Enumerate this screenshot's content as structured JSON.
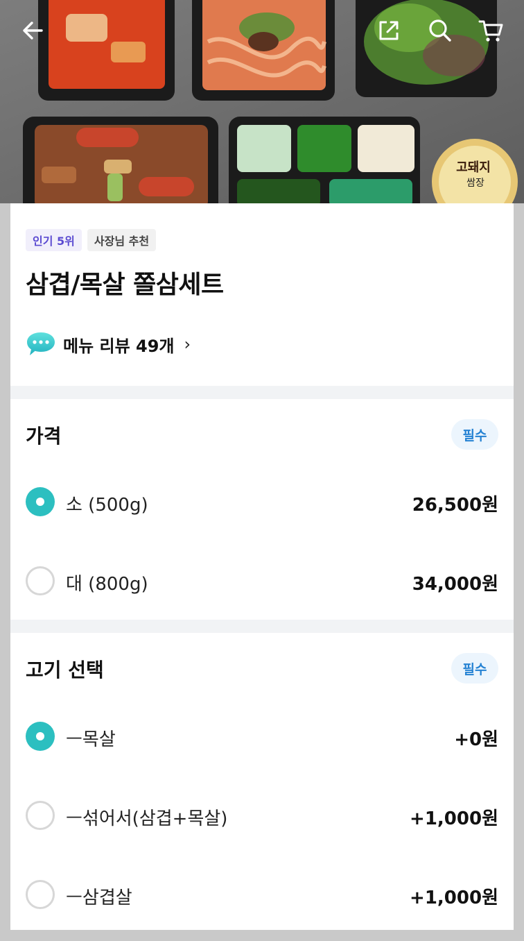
{
  "header": {
    "back_icon": "back-arrow-icon",
    "share_icon": "share-icon",
    "search_icon": "search-icon",
    "cart_icon": "cart-icon"
  },
  "hero": {
    "sauce_brand": "고돼지",
    "sauce_label": "쌈장"
  },
  "menu": {
    "badges": [
      "인기 5위",
      "사장님 추천"
    ],
    "title": "삼겹/목살 쫄삼세트",
    "review_label": "메뉴 리뷰 49개",
    "review_icon": "speech-bubble-icon"
  },
  "price_section": {
    "title": "가격",
    "required": "필수",
    "options": [
      {
        "label": "소 (500g)",
        "price": "26,500원",
        "selected": true
      },
      {
        "label": "대 (800g)",
        "price": "34,000원",
        "selected": false
      }
    ]
  },
  "meat_section": {
    "title": "고기 선택",
    "required": "필수",
    "options": [
      {
        "label": "ㅡ목살",
        "price": "+0원",
        "selected": true
      },
      {
        "label": "ㅡ섞어서(삼겹+목살)",
        "price": "+1,000원",
        "selected": false
      },
      {
        "label": "ㅡ삼겹살",
        "price": "+1,000원",
        "selected": false
      }
    ]
  },
  "colors": {
    "accent_radio": "#2cbfc0",
    "required_text": "#2582d3",
    "badge_popular": "#5b4bd1"
  }
}
